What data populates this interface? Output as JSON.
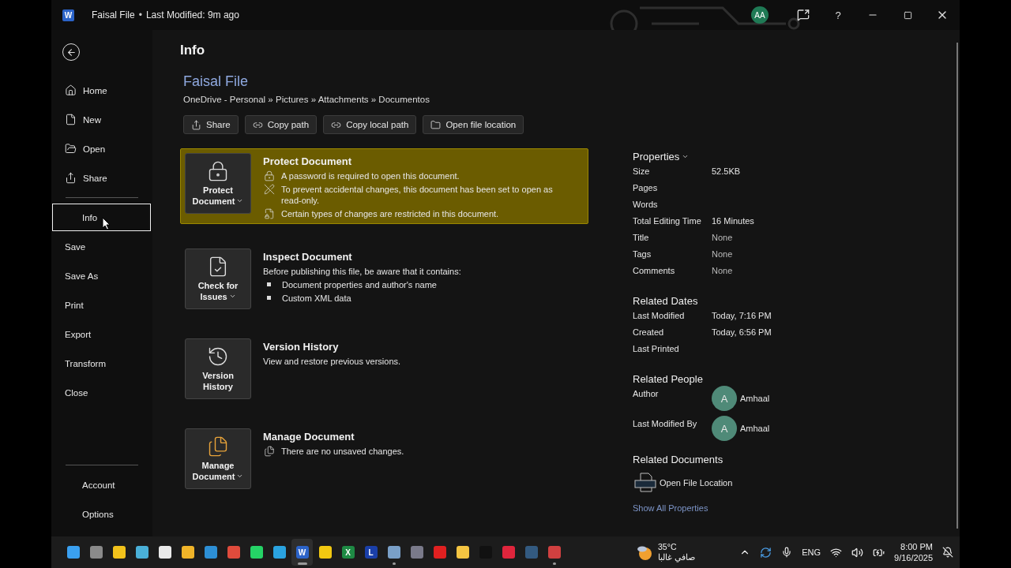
{
  "title_bar": {
    "app_letter": "W",
    "document": "Faisal File",
    "separator": "•",
    "status": "Last Modified: 9m ago",
    "avatar": "AA",
    "help": "?"
  },
  "sidebar": {
    "items": [
      {
        "label": "Home",
        "selected": false
      },
      {
        "label": "New",
        "selected": false
      },
      {
        "label": "Open",
        "selected": false
      },
      {
        "label": "Share",
        "selected": false
      },
      {
        "label": "Info",
        "selected": true
      },
      {
        "label": "Save",
        "selected": false
      },
      {
        "label": "Save As",
        "selected": false
      },
      {
        "label": "Print",
        "selected": false
      },
      {
        "label": "Export",
        "selected": false
      },
      {
        "label": "Transform",
        "selected": false
      },
      {
        "label": "Close",
        "selected": false
      }
    ],
    "bottom_items": [
      {
        "label": "Account",
        "selected": false
      },
      {
        "label": "Options",
        "selected": false
      }
    ]
  },
  "info": {
    "heading": "Info",
    "file_name": "Faisal File",
    "path": "OneDrive - Personal » Pictures » Attachments » Documentos",
    "actions": [
      {
        "label": "Share"
      },
      {
        "label": "Copy path"
      },
      {
        "label": "Copy local path"
      },
      {
        "label": "Open file location"
      }
    ],
    "sections": [
      {
        "button": "Protect Document",
        "has_menu": true,
        "title": "Protect Document",
        "highlighted": true,
        "lines": [
          {
            "kind": "note",
            "text": "A password is required to open this document."
          },
          {
            "kind": "note",
            "text": "To prevent accidental changes, this document has been set to open as read-only."
          },
          {
            "kind": "note",
            "text": "Certain types of changes are restricted in this document."
          }
        ]
      },
      {
        "button": "Check for Issues",
        "has_menu": true,
        "title": "Inspect Document",
        "highlighted": false,
        "lines": [
          {
            "kind": "plain",
            "text": "Before publishing this file, be aware that it contains:"
          },
          {
            "kind": "bullet",
            "text": "Document properties and author's name"
          },
          {
            "kind": "bullet",
            "text": "Custom XML data"
          }
        ]
      },
      {
        "button": "Version History",
        "has_menu": false,
        "title": "Version History",
        "highlighted": false,
        "lines": [
          {
            "kind": "plain",
            "text": "View and restore previous versions."
          }
        ]
      },
      {
        "button": "Manage Document",
        "has_menu": true,
        "title": "Manage Document",
        "highlighted": false,
        "lines": [
          {
            "kind": "note",
            "text": "There are no unsaved changes."
          }
        ]
      }
    ]
  },
  "properties": {
    "heading": "Properties",
    "rows": [
      {
        "label": "Size",
        "value": "52.5KB"
      },
      {
        "label": "Pages"
      },
      {
        "label": "Words"
      },
      {
        "label": "Total Editing Time",
        "value": "16 Minutes"
      },
      {
        "label": "Title",
        "value": "None",
        "muted": true
      },
      {
        "label": "Tags",
        "value": "None",
        "muted": true
      },
      {
        "label": "Comments",
        "value": "None",
        "muted": true
      }
    ],
    "dates_heading": "Related Dates",
    "dates": [
      {
        "label": "Last Modified",
        "value": "Today, 7:16 PM"
      },
      {
        "label": "Created",
        "value": "Today, 6:56 PM"
      },
      {
        "label": "Last Printed"
      }
    ],
    "people_heading": "Related People",
    "people": [
      {
        "label": "Author",
        "initial": "A",
        "name": "Amhaal"
      },
      {
        "label": "Last Modified By",
        "initial": "A",
        "name": "Amhaal"
      }
    ],
    "documents_heading": "Related Documents",
    "documents": [
      {
        "label": "Open File Location"
      }
    ],
    "show_all": "Show All Properties"
  },
  "taskbar": {
    "apps": [
      {
        "selected": false,
        "running": false
      },
      {
        "selected": false,
        "running": false
      },
      {
        "selected": false,
        "running": false
      },
      {
        "selected": false,
        "running": false
      },
      {
        "selected": false,
        "running": false
      },
      {
        "selected": false,
        "running": false
      },
      {
        "selected": false,
        "running": false
      },
      {
        "selected": false,
        "running": false
      },
      {
        "selected": false,
        "running": false
      },
      {
        "selected": false,
        "running": false
      },
      {
        "letter": "W",
        "selected": true,
        "running": true
      },
      {
        "selected": false,
        "running": false
      },
      {
        "letter": "X",
        "selected": false,
        "running": false
      },
      {
        "letter": "L",
        "selected": false,
        "running": false
      },
      {
        "selected": false,
        "running": true
      },
      {
        "selected": false,
        "running": false
      },
      {
        "selected": false,
        "running": false
      },
      {
        "selected": false,
        "running": false
      },
      {
        "selected": false,
        "running": false
      },
      {
        "selected": false,
        "running": false
      },
      {
        "selected": false,
        "running": false
      },
      {
        "selected": false,
        "running": true
      }
    ],
    "weather": {
      "temperature": "35°C",
      "condition": "صافي غالبا"
    },
    "language": "ENG",
    "time": "8:00 PM",
    "date": "9/16/2025"
  }
}
